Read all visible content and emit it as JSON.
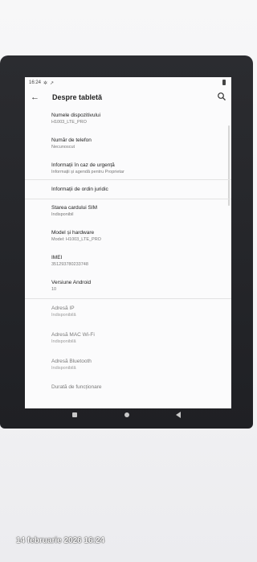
{
  "status_bar": {
    "time": "16:24",
    "icons": [
      "gear-icon",
      "cast-icon"
    ]
  },
  "app_bar": {
    "title": "Despre tabletă",
    "back_icon": "arrow-left-icon",
    "search_icon": "search-icon"
  },
  "items": [
    {
      "title": "Numele dispozitivului",
      "subtitle": "H1003_LTE_PRO"
    },
    {
      "title": "Număr de telefon",
      "subtitle": "Necunoscut"
    },
    {
      "title": "Informații în caz de urgență",
      "subtitle": "Informații și agendă pentru Proprietar"
    },
    {
      "title": "Informații de ordin juridic",
      "subtitle": ""
    },
    {
      "title": "Starea cardului SIM",
      "subtitle": "Indisponibil"
    },
    {
      "title": "Model și hardware",
      "subtitle": "Model: H1003_LTE_PRO"
    },
    {
      "title": "IMEI",
      "subtitle": "351293780233748"
    },
    {
      "title": "Versiune Android",
      "subtitle": "10"
    },
    {
      "title": "Adresă IP",
      "subtitle": "Indisponibilă"
    },
    {
      "title": "Adresă MAC Wi-Fi",
      "subtitle": "Indisponibilă"
    },
    {
      "title": "Adresă Bluetooth",
      "subtitle": "Indisponibilă"
    },
    {
      "title": "Durată de funcționare",
      "subtitle": ""
    }
  ],
  "nav_bar": {
    "recent_icon": "square-recent-icon",
    "home_icon": "circle-home-icon",
    "back_icon": "triangle-back-icon"
  },
  "photo_timestamp": "14 februarie 2026 16:24"
}
